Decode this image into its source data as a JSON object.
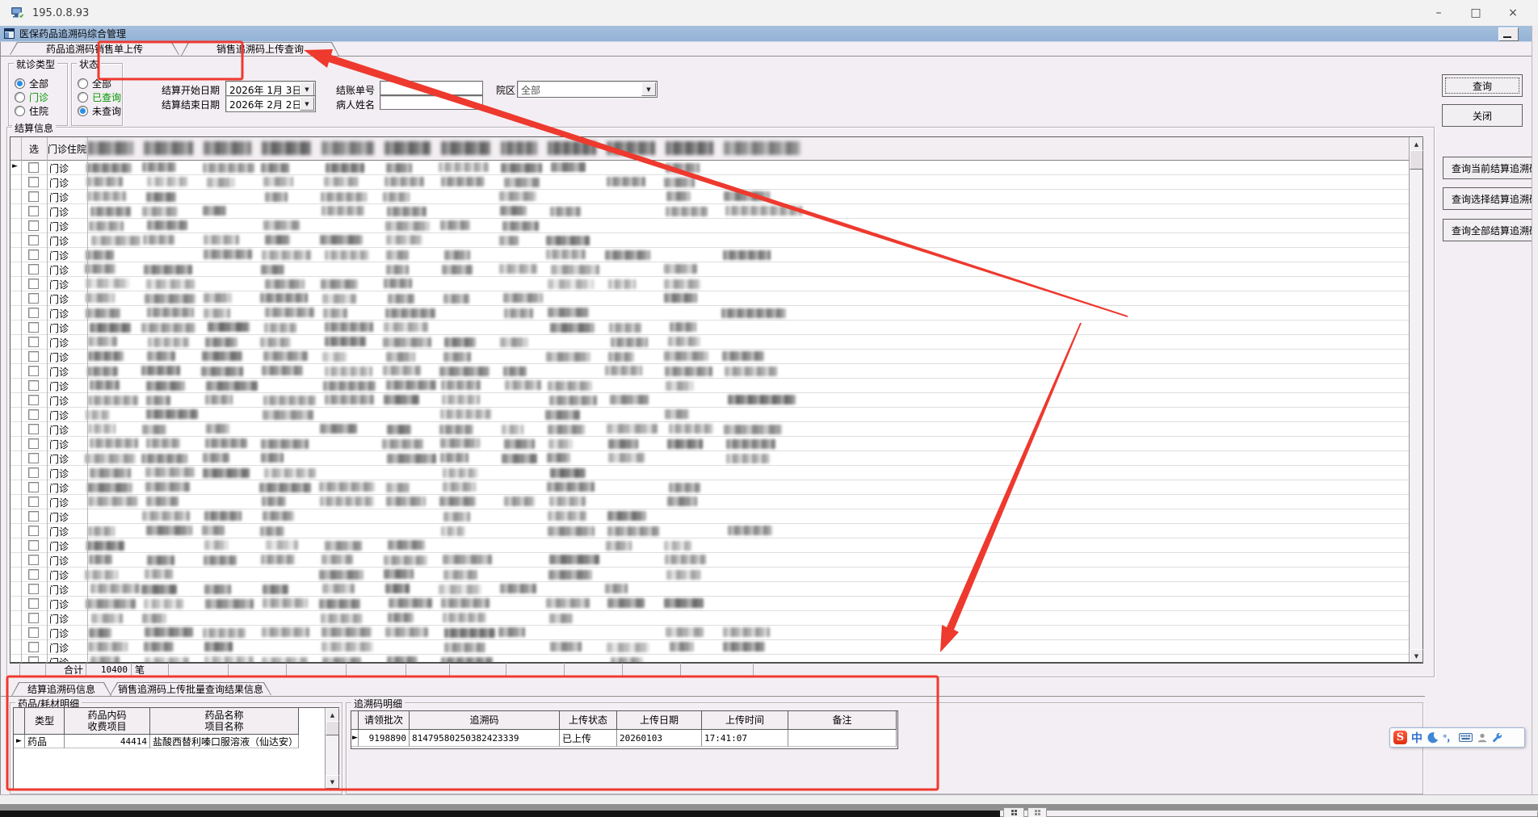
{
  "window": {
    "title": "195.0.8.93"
  },
  "window_controls": {
    "minimize": "–",
    "maximize": "□",
    "close": "×"
  },
  "mdi": {
    "title": "医保药品追溯码综合管理"
  },
  "tabs": [
    {
      "label": "药品追溯码销售单上传",
      "active": false
    },
    {
      "label": "销售追溯码上传查询",
      "active": true
    }
  ],
  "filters": {
    "visit_type": {
      "label": "就诊类型",
      "options": [
        {
          "label": "全部",
          "selected": true,
          "green": false
        },
        {
          "label": "门诊",
          "selected": false,
          "green": true
        },
        {
          "label": "住院",
          "selected": false,
          "green": false
        }
      ]
    },
    "status": {
      "label": "状态",
      "options": [
        {
          "label": "全部",
          "selected": false,
          "green": false
        },
        {
          "label": "已查询",
          "selected": false,
          "green": true
        },
        {
          "label": "未查询",
          "selected": true,
          "green": false
        }
      ]
    },
    "start_date": {
      "label": "结算开始日期",
      "value": "2026年 1月 3日"
    },
    "end_date": {
      "label": "结算结束日期",
      "value": "2026年 2月 2日"
    },
    "bill_no": {
      "label": "结账单号",
      "value": ""
    },
    "patient": {
      "label": "病人姓名",
      "value": ""
    },
    "campus": {
      "label": "院区",
      "value": "全部"
    }
  },
  "buttons": {
    "query": "查询",
    "close": "关闭",
    "query_current": "查询当前结算追溯码",
    "query_select": "查询选择结算追溯码",
    "query_all": "查询全部结算追溯码"
  },
  "settlement": {
    "title": "结算信息",
    "col_select": "选",
    "col_visit": "门诊住院",
    "row_visit_type": "门诊",
    "row_count": 37,
    "total_label": "合计",
    "total_value": "10400",
    "total_unit": "笔"
  },
  "bottom_tabs": [
    {
      "label": "结算追溯码信息",
      "active": true
    },
    {
      "label": "销售追溯码上传批量查询结果信息",
      "active": false
    }
  ],
  "drug_detail": {
    "title": "药品/耗材明细",
    "columns": [
      [
        "类型"
      ],
      [
        "药品内码",
        "收费项目"
      ],
      [
        "药品名称",
        "项目名称"
      ]
    ],
    "rows": [
      [
        "药品",
        "44414",
        "盐酸西替利嗪口服溶液（仙达安）"
      ]
    ]
  },
  "trace_detail": {
    "title": "追溯码明细",
    "columns": [
      "请领批次",
      "追溯码",
      "上传状态",
      "上传日期",
      "上传时间",
      "备注"
    ],
    "rows": [
      [
        "9198890",
        "81479580250382423339",
        "已上传",
        "20260103",
        "17:41:07",
        ""
      ]
    ]
  },
  "ime": {
    "logo_letter": "S",
    "lang_label": "中",
    "punct_label": "°，"
  },
  "icons": {
    "up_arrow": "▲",
    "down_arrow": "▼",
    "dropdown_arrow": "▼",
    "row_pointer": "►"
  },
  "colors": {
    "annotation_red": "#ee392e",
    "mdi_blue": "#a6c0de",
    "green_option": "#009600",
    "radio_selected_blue": "#2a8ee8"
  }
}
